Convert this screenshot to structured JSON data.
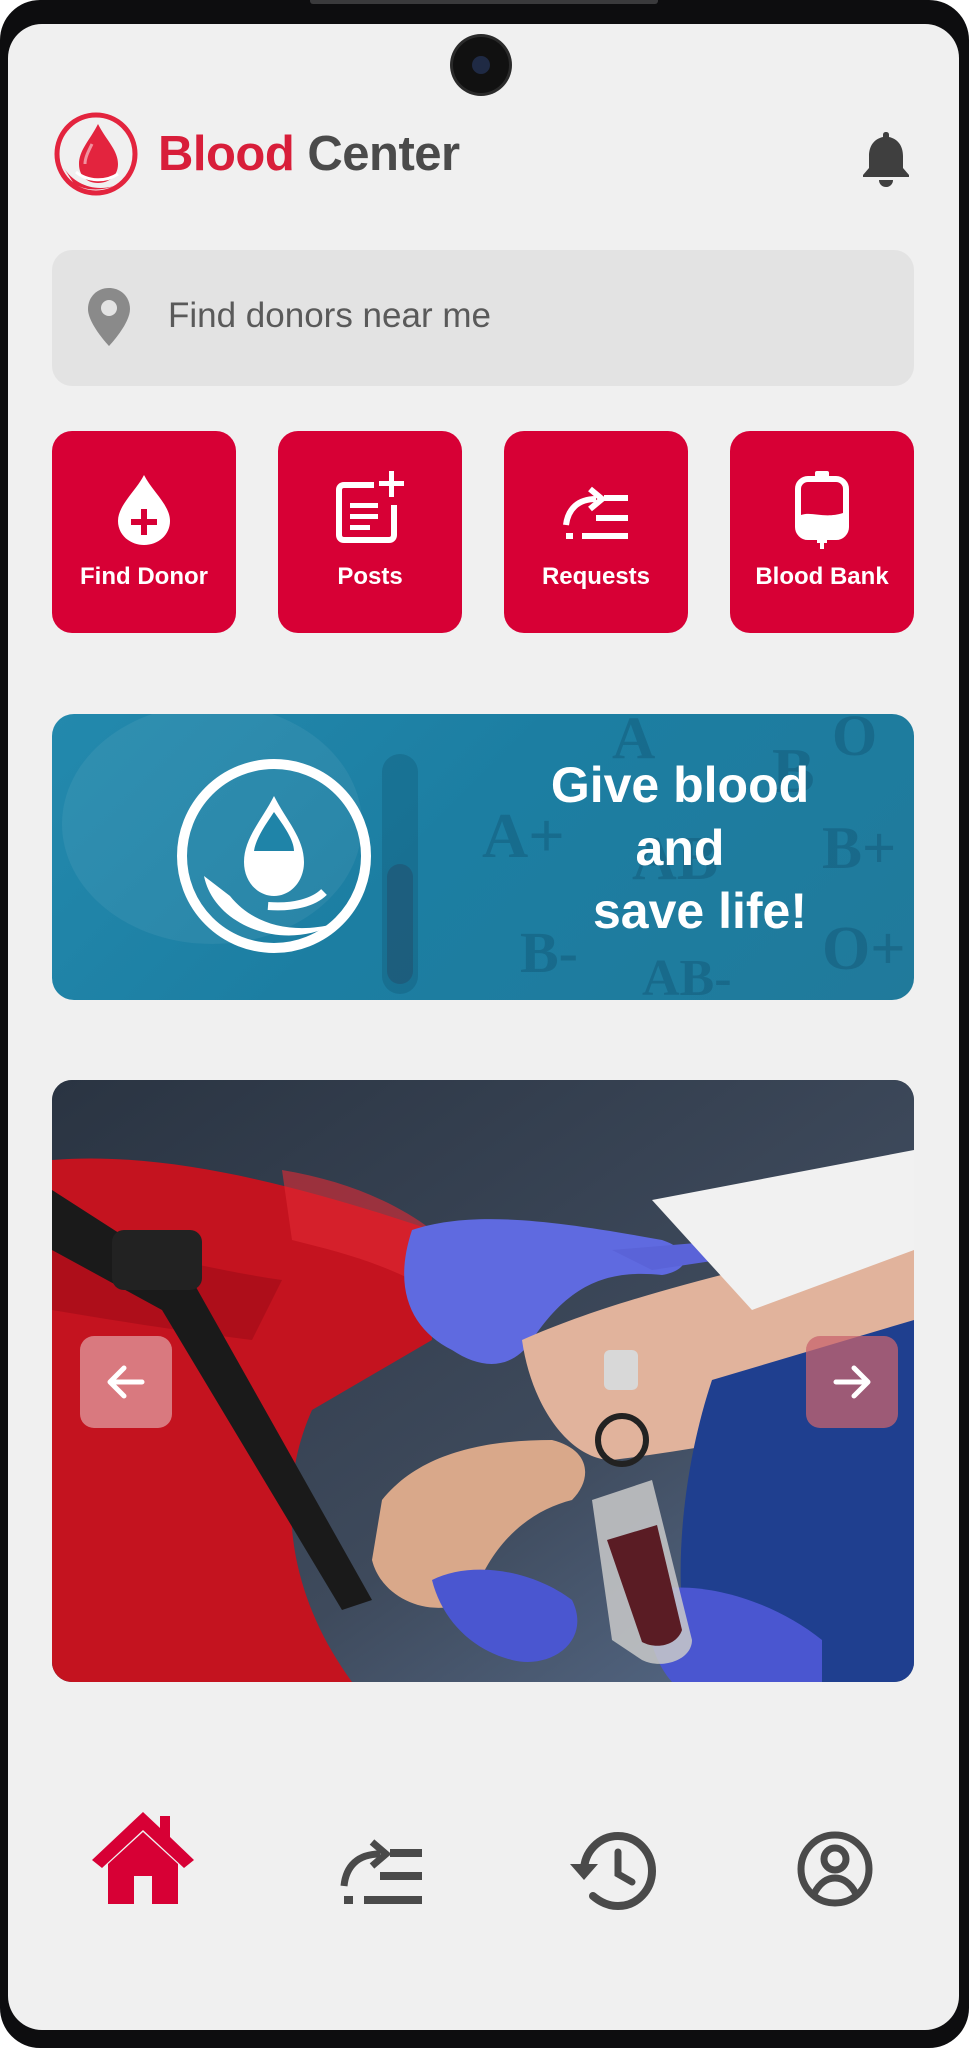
{
  "app": {
    "title_part1": "Blood",
    "title_part2": "Center"
  },
  "search": {
    "placeholder": "Find donors near me"
  },
  "quick_actions": [
    {
      "label": "Find Donor",
      "icon": "blood-drop-plus-icon"
    },
    {
      "label": "Posts",
      "icon": "add-post-icon"
    },
    {
      "label": "Requests",
      "icon": "requests-list-icon"
    },
    {
      "label": "Blood Bank",
      "icon": "blood-bag-icon"
    }
  ],
  "banner": {
    "line1": "Give blood",
    "line2": "and",
    "line3": "save life!",
    "background_letters": [
      "A",
      "B",
      "B+",
      "A+",
      "AB",
      "B-",
      "AB-",
      "O+",
      "O"
    ]
  },
  "carousel": {
    "image": "blood-donation-photo",
    "prev_icon": "arrow-left-icon",
    "next_icon": "arrow-right-icon"
  },
  "bottom_nav": [
    {
      "name": "home",
      "icon": "home-icon",
      "active": true
    },
    {
      "name": "requests",
      "icon": "requests-list-icon",
      "active": false
    },
    {
      "name": "history",
      "icon": "history-icon",
      "active": false
    },
    {
      "name": "profile",
      "icon": "profile-icon",
      "active": false
    }
  ],
  "colors": {
    "brand_red": "#d70035",
    "title_red": "#d81e3a",
    "title_gray": "#4a4a4a",
    "banner_teal": "#1f84a8",
    "icon_gray": "#4a4a4a",
    "screen_bg": "#f0f0f0"
  }
}
